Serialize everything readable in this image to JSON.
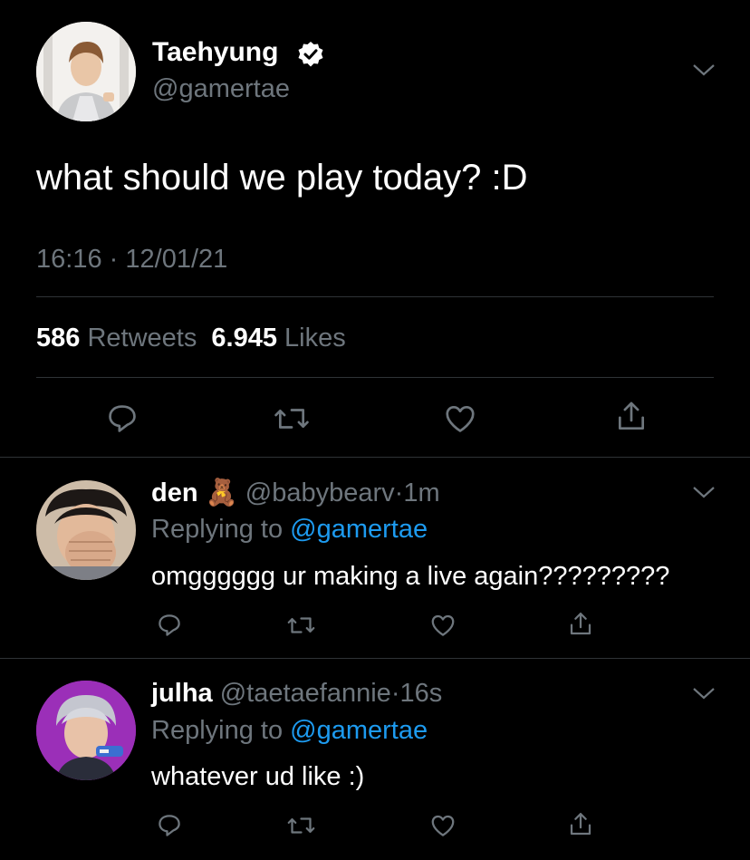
{
  "main_tweet": {
    "author_name": "Taehyung",
    "author_handle": "@gamertae",
    "verified_icon": "verified-badge-icon",
    "text": "what should we play today? :D",
    "time": "16:16",
    "separator": "·",
    "date": "12/01/21",
    "retweets_count": "586",
    "retweets_label": "Retweets",
    "likes_count": "6.945",
    "likes_label": "Likes"
  },
  "replies": [
    {
      "author_name": "den",
      "emoji": "🧸",
      "author_handle": "@babybearv",
      "separator": "·",
      "time": "1m",
      "replying_prefix": "Replying to",
      "replying_handle": "@gamertae",
      "text": "omgggggg ur making a live again?????????"
    },
    {
      "author_name": "julha",
      "author_handle": "@taetaefannie",
      "separator": "·",
      "time": "16s",
      "replying_prefix": "Replying to",
      "replying_handle": "@gamertae",
      "text": "whatever ud like :)"
    }
  ],
  "colors": {
    "background": "#000000",
    "muted": "#6e767d",
    "link": "#1d9bf0",
    "divider": "#2f3336"
  },
  "icons": [
    "reply-icon",
    "retweet-icon",
    "like-icon",
    "share-icon",
    "chevron-down-icon"
  ]
}
